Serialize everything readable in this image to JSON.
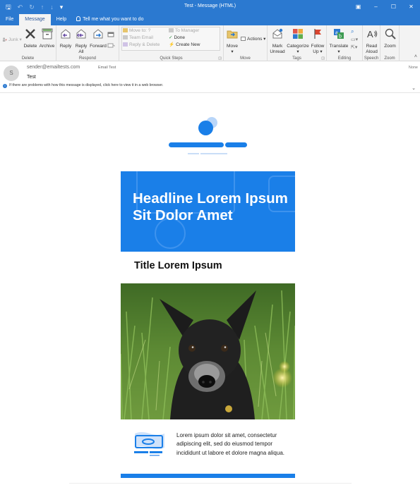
{
  "window": {
    "title": "Test  -  Message (HTML)",
    "controls": [
      "▣",
      "–",
      "☐",
      "✕"
    ],
    "qat_icons": [
      "save-icon",
      "undo-icon",
      "redo-icon",
      "up-icon",
      "down-icon",
      "customize-icon"
    ]
  },
  "tabs": [
    "File",
    "Message",
    "Help"
  ],
  "active_tab": "Message",
  "tell_me": "Tell me what you want to do",
  "ribbon": {
    "delete_group": {
      "label": "Delete",
      "junk": "Junk",
      "delete": "Delete",
      "archive": "Archive"
    },
    "respond_group": {
      "label": "Respond",
      "reply": "Reply",
      "reply_all_1": "Reply",
      "reply_all_2": "All",
      "forward": "Forward"
    },
    "quick_steps": {
      "label": "Quick Steps",
      "items": [
        "Move to: ?",
        "Team Email",
        "Reply & Delete",
        "To Manager",
        "Done",
        "Create New"
      ]
    },
    "move_group": {
      "label": "Move",
      "move": "Move",
      "actions": "Actions"
    },
    "tags_group": {
      "label": "Tags",
      "mark_unread_1": "Mark",
      "mark_unread_2": "Unread",
      "categorize": "Categorize",
      "follow_up_1": "Follow",
      "follow_up_2": "Up"
    },
    "editing_group": {
      "label": "Editing",
      "translate": "Translate"
    },
    "speech_group": {
      "label": "Speech",
      "read_aloud_1": "Read",
      "read_aloud_2": "Aloud"
    },
    "zoom_group": {
      "label": "Zoom",
      "zoom": "Zoom"
    }
  },
  "message": {
    "avatar_initial": "S",
    "sender": "sender@emailtests.com",
    "recipient": "Email Test",
    "subject": "Test",
    "importance": "None",
    "info_bar": "If there are problems with how this message is displayed, click here to view it in a web browser."
  },
  "email": {
    "hero_headline": "Headline Lorem Ipsum Sit Dolor Amet",
    "title": "Title Lorem Ipsum",
    "feature_text": "Lorem ipsum dolor sit amet, consectetur adipiscing elit, sed do eiusmod tempor incididunt ut labore et dolore magna aliqua."
  },
  "colors": {
    "brand_blue": "#1a7fe8",
    "titlebar_blue": "#2b79d0"
  }
}
